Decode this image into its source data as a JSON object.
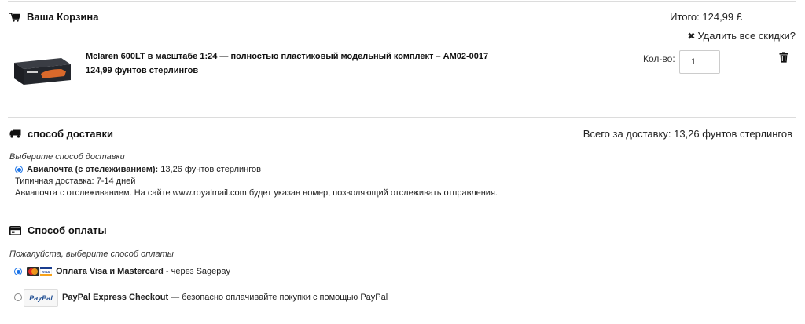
{
  "cart": {
    "title": "Ваша Корзина",
    "total": "Итого: 124,99 £",
    "remove_discounts": "Удалить все скидки?",
    "product": {
      "name": "Mclaren 600LT в масштабе 1:24 — полностью пластиковый модельный комплект – AM02-0017",
      "price": "124,99 фунтов стерлингов"
    },
    "qty_label": "Кол-во:",
    "qty_value": "1"
  },
  "delivery": {
    "title": "способ доставки",
    "total": "Всего за доставку: 13,26 фунтов стерлингов",
    "hint": "Выберите способ доставки",
    "option_name": "Авиапочта (с отслеживанием):",
    "option_price": " 13,26 фунтов стерлингов",
    "typical": "Типичная доставка: 7-14 дней",
    "description": "Авиапочта с отслеживанием. На сайте www.royalmail.com будет указан номер, позволяющий отслеживать отправления."
  },
  "payment": {
    "title": "Способ оплаты",
    "hint": "Пожалуйста, выберите способ оплаты",
    "card_name": "Оплата Visa и Mastercard",
    "card_via": " - через Sagepay",
    "paypal_logo": "PayPal",
    "paypal_name": "PayPal Express Checkout",
    "paypal_desc": " — безопасно оплачивайте покупки с помощью PayPal"
  },
  "colors": {
    "accent": "#1a73e8",
    "divider": "#dcdcdc"
  }
}
